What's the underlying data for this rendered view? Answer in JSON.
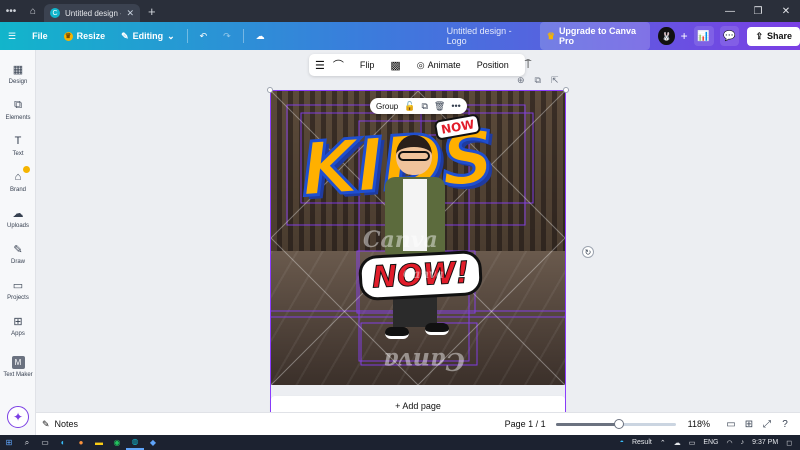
{
  "browser": {
    "tab_title": "Untitled design - L...",
    "tab_favicon": "C"
  },
  "header": {
    "file_label": "File",
    "resize_label": "Resize",
    "editing_label": "Editing",
    "doc_title": "Untitled design - Logo",
    "upgrade_label": "Upgrade to Canva Pro",
    "share_label": "Share"
  },
  "sidebar": {
    "items": [
      {
        "label": "Design",
        "icon": "design-icon"
      },
      {
        "label": "Elements",
        "icon": "elements-icon"
      },
      {
        "label": "Text",
        "icon": "text-icon"
      },
      {
        "label": "Brand",
        "icon": "brand-icon"
      },
      {
        "label": "Uploads",
        "icon": "uploads-icon"
      },
      {
        "label": "Draw",
        "icon": "draw-icon"
      },
      {
        "label": "Projects",
        "icon": "projects-icon"
      },
      {
        "label": "Apps",
        "icon": "apps-icon"
      },
      {
        "label": "Text Maker",
        "icon": "text-maker-icon"
      }
    ]
  },
  "toolbar": {
    "flip_label": "Flip",
    "animate_label": "Animate",
    "position_label": "Position"
  },
  "selection": {
    "group_label": "Group"
  },
  "canvas": {
    "headline": "KIDS",
    "badge_small": "NOW",
    "badge_big": "NOW!",
    "watermark": "Canva"
  },
  "add_page_label": "+ Add page",
  "bottom": {
    "notes_label": "Notes",
    "page_indicator": "Page 1 / 1",
    "zoom_label": "118%",
    "zoom_fraction": 0.53
  },
  "taskbar": {
    "weather_label": "Result",
    "language": "ENG",
    "time": "9:37 PM"
  },
  "colors": {
    "accent": "#8b3dff",
    "header_start": "#12b5cb",
    "header_end": "#7b3fe4"
  }
}
